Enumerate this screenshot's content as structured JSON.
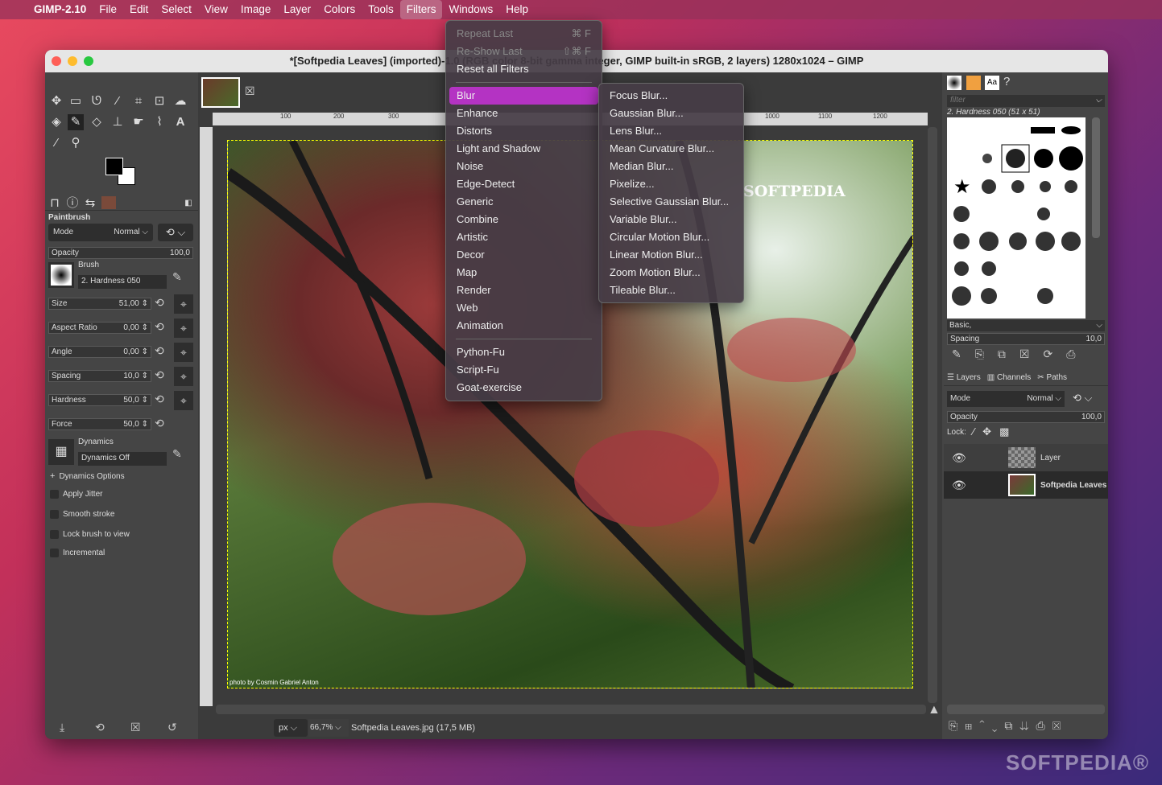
{
  "menubar": {
    "app": "GIMP-2.10",
    "items": [
      "File",
      "Edit",
      "Select",
      "View",
      "Image",
      "Layer",
      "Colors",
      "Tools",
      "Filters",
      "Windows",
      "Help"
    ]
  },
  "window": {
    "title": "*[Softpedia Leaves] (imported)-1.0 (RGB color 8-bit gamma integer, GIMP built-in sRGB, 2 layers) 1280x1024 – GIMP"
  },
  "filters_menu": {
    "items": [
      {
        "label": "Repeat Last",
        "shortcut": "⌘ F",
        "disabled": true
      },
      {
        "label": "Re-Show Last",
        "shortcut": "⇧⌘ F",
        "disabled": true
      },
      {
        "label": "Reset all Filters"
      }
    ],
    "groups": [
      "Blur",
      "Enhance",
      "Distorts",
      "Light and Shadow",
      "Noise",
      "Edge-Detect",
      "Generic",
      "Combine",
      "Artistic",
      "Decor",
      "Map",
      "Render",
      "Web",
      "Animation"
    ],
    "scripts": [
      "Python-Fu",
      "Script-Fu",
      "Goat-exercise"
    ],
    "selected": "Blur"
  },
  "blur_menu": [
    "Focus Blur...",
    "Gaussian Blur...",
    "Lens Blur...",
    "Mean Curvature Blur...",
    "Median Blur...",
    "Pixelize...",
    "Selective Gaussian Blur...",
    "Variable Blur...",
    "Circular Motion Blur...",
    "Linear Motion Blur...",
    "Zoom Motion Blur...",
    "Tileable Blur..."
  ],
  "tool_options": {
    "title": "Paintbrush",
    "mode_label": "Mode",
    "mode": "Normal",
    "opacity_label": "Opacity",
    "opacity": "100,0",
    "brush_label": "Brush",
    "brush": "2. Hardness 050",
    "sliders": [
      {
        "label": "Size",
        "value": "51,00"
      },
      {
        "label": "Aspect Ratio",
        "value": "0,00"
      },
      {
        "label": "Angle",
        "value": "0,00"
      },
      {
        "label": "Spacing",
        "value": "10,0"
      },
      {
        "label": "Hardness",
        "value": "50,0"
      },
      {
        "label": "Force",
        "value": "50,0"
      }
    ],
    "dynamics_label": "Dynamics",
    "dynamics": "Dynamics Off",
    "dynamics_options": "Dynamics Options",
    "checks": [
      "Apply Jitter",
      "Smooth stroke",
      "Lock brush to view",
      "Incremental"
    ]
  },
  "canvas": {
    "rulers": [
      "100",
      "200",
      "300",
      "1000",
      "1100",
      "1200"
    ],
    "watermark": "SOFTPEDIA",
    "credit": "photo by Cosmin Gabriel Anton"
  },
  "status": {
    "unit": "px",
    "zoom": "66,7%",
    "file": "Softpedia Leaves.jpg (17,5 MB)"
  },
  "brushes": {
    "filter_placeholder": "filter",
    "selected": "2. Hardness 050 (51 x 51)",
    "tag": "Basic,",
    "spacing_label": "Spacing",
    "spacing": "10,0"
  },
  "layers": {
    "tabs": [
      "Layers",
      "Channels",
      "Paths"
    ],
    "mode_label": "Mode",
    "mode": "Normal",
    "opacity_label": "Opacity",
    "opacity": "100,0",
    "lock_label": "Lock:",
    "items": [
      "Layer",
      "Softpedia Leaves"
    ]
  },
  "footer_watermark": "SOFTPEDIA®"
}
